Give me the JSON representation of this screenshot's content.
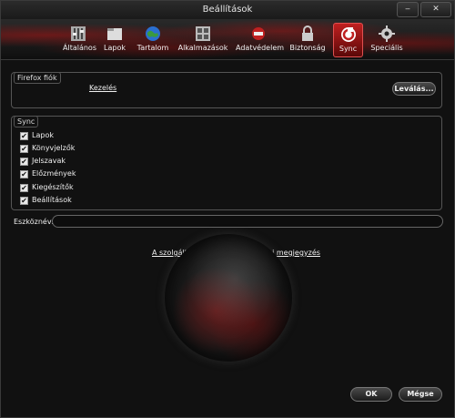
{
  "window": {
    "title": "Beállítások",
    "controls": [
      "‒",
      "✕"
    ]
  },
  "toolbar": {
    "tabs": [
      {
        "label": "Általános",
        "icon": "switches-icon"
      },
      {
        "label": "Lapok",
        "icon": "tabs-icon"
      },
      {
        "label": "Tartalom",
        "icon": "globe-icon"
      },
      {
        "label": "Alkalmazások",
        "icon": "applications-icon"
      },
      {
        "label": "Adatvédelem",
        "icon": "privacy-mask-icon"
      },
      {
        "label": "Biztonság",
        "icon": "padlock-icon"
      },
      {
        "label": "Sync",
        "icon": "sync-icon"
      },
      {
        "label": "Speciális",
        "icon": "gear-icon"
      }
    ],
    "active_tab": "Sync"
  },
  "account": {
    "legend": "Firefox fiók",
    "manage_link": "Kezelés",
    "disconnect_button": "Leválás..."
  },
  "sync": {
    "legend": "Sync",
    "items": [
      {
        "label": "Lapok",
        "checked": true
      },
      {
        "label": "Könyvjelzők",
        "checked": true
      },
      {
        "label": "Jelszavak",
        "checked": true
      },
      {
        "label": "Előzmények",
        "checked": true
      },
      {
        "label": "Kiegészítők",
        "checked": true
      },
      {
        "label": "Beállítások",
        "checked": true
      }
    ]
  },
  "device": {
    "label": "Eszköznév:",
    "value": ""
  },
  "links": {
    "terms": "A szolgáltatás feltételei",
    "privacy": "Adatvédelmi megjegyzés"
  },
  "buttons": {
    "ok": "OK",
    "cancel": "Mégse"
  },
  "colors": {
    "accent": "#c02020",
    "background": "#111111"
  }
}
